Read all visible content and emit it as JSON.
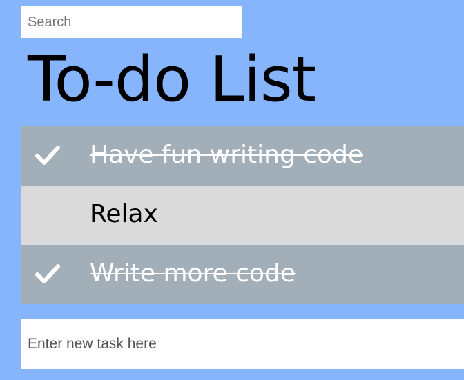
{
  "colors": {
    "background": "#87b5fb",
    "done_item": "#a2aeb8",
    "open_item": "#dadada",
    "input_bg": "#ffffff"
  },
  "search": {
    "value": "",
    "placeholder": "Search",
    "icon": null
  },
  "title": "To-do List",
  "tasks": [
    {
      "label": "Have fun writing code",
      "completed": true,
      "icon": "check-icon"
    },
    {
      "label": "Relax",
      "completed": false,
      "icon": null
    },
    {
      "label": "Write more code",
      "completed": true,
      "icon": "check-icon"
    }
  ],
  "new_task": {
    "value": "",
    "placeholder": "Enter new task here"
  }
}
